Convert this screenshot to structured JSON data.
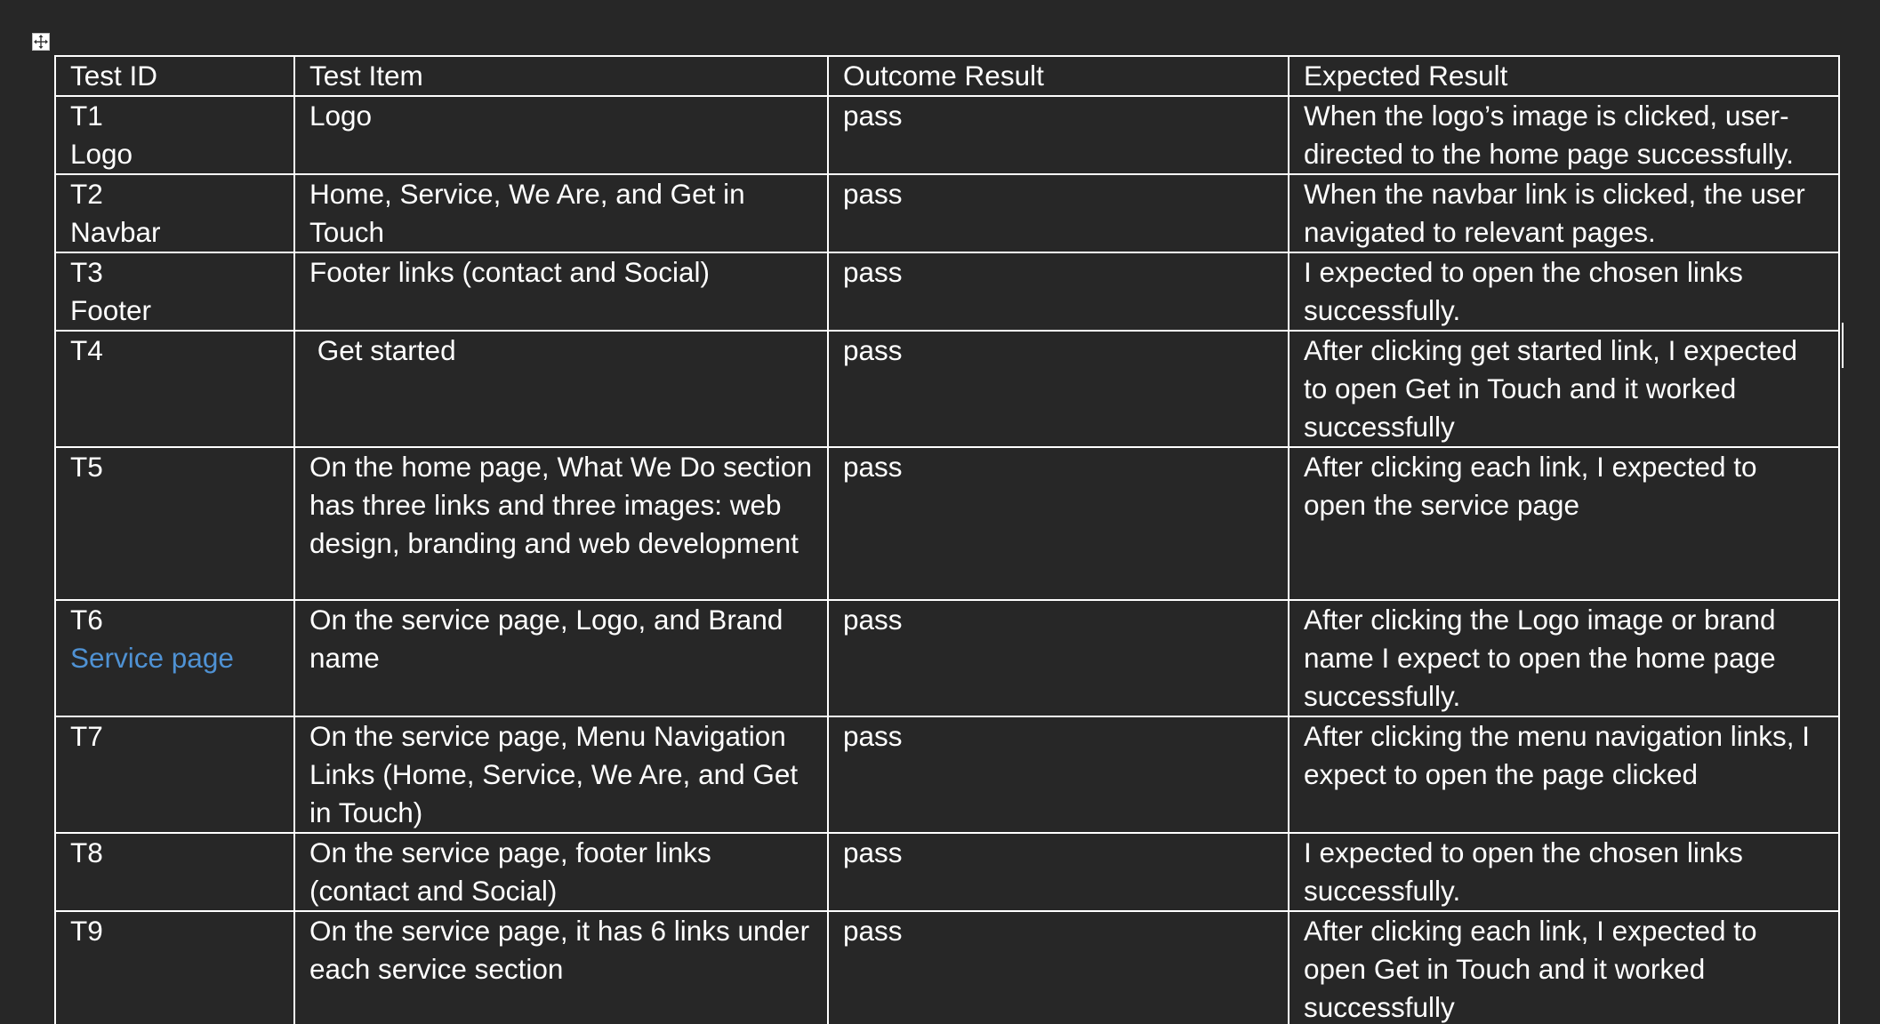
{
  "colors": {
    "background": "#272727",
    "text": "#ffffff",
    "border": "#ffffff",
    "link_text": "#4f92d4"
  },
  "icons": {
    "table_move_handle": "move-arrows-icon"
  },
  "table": {
    "headers": [
      "Test ID",
      "Test Item",
      "Outcome Result",
      "Expected Result"
    ],
    "rows": [
      {
        "id": "T1",
        "id_sub": "Logo",
        "item": "Logo",
        "outcome": "pass",
        "expected": "When the logo’s image is clicked, user-directed to the home page successfully."
      },
      {
        "id": "T2",
        "id_sub": "Navbar",
        "item": "Home, Service, We Are, and Get in Touch",
        "outcome": "pass",
        "expected": "When the navbar link is clicked, the user navigated to relevant pages."
      },
      {
        "id": "T3",
        "id_sub": "Footer",
        "item": "Footer links (contact and Social)",
        "outcome": "pass",
        "expected": "I expected to open the chosen links successfully."
      },
      {
        "id": "T4",
        "id_sub": "",
        "item": " Get started",
        "outcome": "pass",
        "expected": "After clicking get started link, I expected to open Get in Touch and it worked successfully"
      },
      {
        "id": "T5",
        "id_sub": "",
        "item": "On the home page, What We Do section has three links and three images: web design, branding and web development",
        "outcome": "pass",
        "expected": "After clicking each link, I expected to open the service page"
      },
      {
        "id": "T6",
        "id_sub": "Service page",
        "item": "On the service page, Logo, and Brand name",
        "outcome": "pass",
        "expected": "After clicking the Logo image or brand name I expect to open the home page successfully."
      },
      {
        "id": "T7",
        "id_sub": "",
        "item": "On the service page, Menu Navigation Links (Home, Service, We Are, and Get in Touch)",
        "outcome": "pass",
        "expected": "After clicking the menu navigation links, I expect to open the page clicked"
      },
      {
        "id": "T8",
        "id_sub": "",
        "item": "On the service page, footer links (contact and Social)",
        "outcome": "pass",
        "expected": "I expected to open the chosen links successfully."
      },
      {
        "id": "T9",
        "id_sub": "",
        "item": "On the service page, it has 6 links under each service section",
        "outcome": "pass",
        "expected": "After clicking each link, I expected to open Get in Touch and it worked successfully"
      }
    ]
  }
}
